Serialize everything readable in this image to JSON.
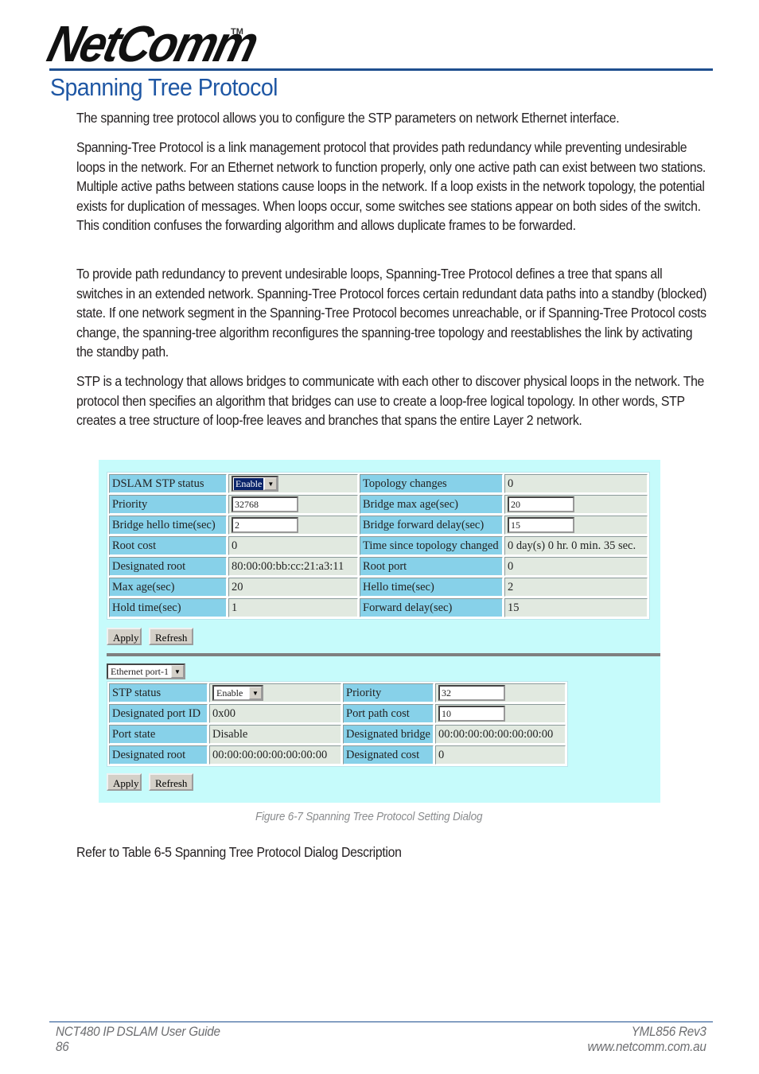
{
  "brand": {
    "logo_text": "NetComm",
    "trademark": "TM",
    "accent_color": "#1f57a4"
  },
  "page_title": "Spanning Tree Protocol",
  "paragraphs": [
    "The spanning tree protocol allows you to configure the STP parameters on network Ethernet interface.",
    "Spanning-Tree Protocol is a link management protocol that provides path redundancy while preventing undesirable loops in the network. For an Ethernet network to function properly, only one active path can exist between two stations. Multiple active paths between stations cause loops in the network. If a loop exists in the network topology, the potential exists for duplication of messages. When loops occur, some switches see stations appear on both sides of the switch. This condition confuses the forwarding algorithm and allows duplicate frames to be forwarded.",
    "To provide path redundancy to prevent undesirable loops, Spanning-Tree Protocol defines a tree that spans all switches in an extended network. Spanning-Tree Protocol forces certain redundant data paths into a standby (blocked) state. If one network segment in the Spanning-Tree Protocol becomes unreachable, or if Spanning-Tree Protocol costs change, the spanning-tree algorithm reconfigures the spanning-tree topology and reestablishes the link by activating the standby path.",
    "STP is a technology that allows bridges to communicate with each other to discover physical loops in the network. The protocol then specifies an algorithm that bridges can use to create a loop-free logical topology. In other words, STP creates a tree structure of loop-free leaves and branches that spans the entire Layer 2 network."
  ],
  "bridge_table": {
    "rows": [
      {
        "l1": "DSLAM STP status",
        "v1": "Enable",
        "l2": "Topology changes",
        "v2": "0"
      },
      {
        "l1": "Priority",
        "v1": "32768",
        "l2": "Bridge max age(sec)",
        "v2": "20"
      },
      {
        "l1": "Bridge hello time(sec)",
        "v1": "2",
        "l2": "Bridge forward delay(sec)",
        "v2": "15"
      },
      {
        "l1": "Root cost",
        "v1": "0",
        "l2": "Time since topology changed",
        "v2": "0 day(s) 0 hr. 0 min. 35 sec."
      },
      {
        "l1": "Designated root",
        "v1": "80:00:00:bb:cc:21:a3:11",
        "l2": "Root port",
        "v2": "0"
      },
      {
        "l1": "Max age(sec)",
        "v1": "20",
        "l2": "Hello time(sec)",
        "v2": "2"
      },
      {
        "l1": "Hold time(sec)",
        "v1": "1",
        "l2": "Forward delay(sec)",
        "v2": "15"
      }
    ],
    "apply_label": "Apply",
    "refresh_label": "Refresh"
  },
  "port_table": {
    "port_select": "Ethernet port-1",
    "rows": [
      {
        "l1": "STP status",
        "v1": "Enable",
        "l2": "Priority",
        "v2": "32"
      },
      {
        "l1": "Designated port ID",
        "v1": "0x00",
        "l2": "Port path cost",
        "v2": "10"
      },
      {
        "l1": "Port state",
        "v1": "Disable",
        "l2": "Designated bridge",
        "v2": "00:00:00:00:00:00:00:00"
      },
      {
        "l1": "Designated root",
        "v1": "00:00:00:00:00:00:00:00",
        "l2": "Designated cost",
        "v2": "0"
      }
    ],
    "apply_label": "Apply",
    "refresh_label": "Refresh"
  },
  "caption": "Figure 6-7 Spanning Tree Protocol Setting Dialog",
  "refer_text": "Refer to Table 6-5 Spanning Tree Protocol Dialog Description",
  "footer": {
    "guide_title": "NCT480 IP DSLAM User Guide",
    "page_number": "86",
    "revision": "YML856 Rev3",
    "website": "www.netcomm.com.au"
  }
}
